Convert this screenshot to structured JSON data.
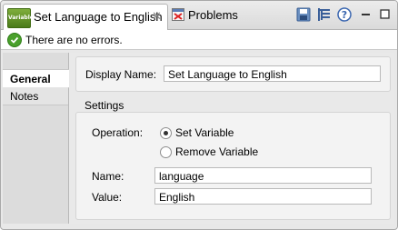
{
  "tabs": [
    {
      "label": "Set Language to English",
      "icon": "variable-icon",
      "icon_text": "Variable",
      "active": true
    },
    {
      "label": "Problems",
      "icon": "problems-icon",
      "active": false
    }
  ],
  "toolbar": {
    "icons": [
      "save-icon",
      "hierarchy-icon",
      "help-icon",
      "minimize-icon",
      "maximize-icon"
    ]
  },
  "status": {
    "text": "There are no errors.",
    "icon": "check-icon"
  },
  "nav": {
    "items": [
      {
        "label": "General",
        "selected": true
      },
      {
        "label": "Notes",
        "selected": false
      }
    ]
  },
  "general": {
    "display_name_label": "Display Name:",
    "display_name_value": "Set Language to English"
  },
  "settings": {
    "title": "Settings",
    "operation_label": "Operation:",
    "options": [
      {
        "label": "Set Variable",
        "checked": true
      },
      {
        "label": "Remove Variable",
        "checked": false
      }
    ],
    "name_label": "Name:",
    "name_value": "language",
    "value_label": "Value:",
    "value_value": "English"
  },
  "colors": {
    "accent_green": "#4aa02c",
    "variable_icon": "#5f8f25"
  }
}
